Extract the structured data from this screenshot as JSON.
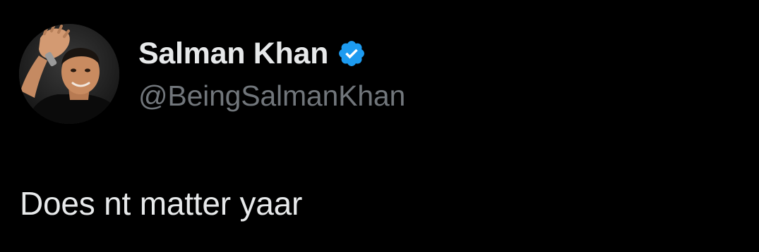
{
  "author": {
    "display_name": "Salman Khan",
    "handle": "@BeingSalmanKhan",
    "verified": true,
    "avatar_icon": "profile-photo-avatar"
  },
  "tweet": {
    "text": "Does nt matter yaar"
  },
  "colors": {
    "background": "#000000",
    "primary_text": "#e7e9ea",
    "secondary_text": "#71767b",
    "verified_badge": "#1d9bf0"
  }
}
